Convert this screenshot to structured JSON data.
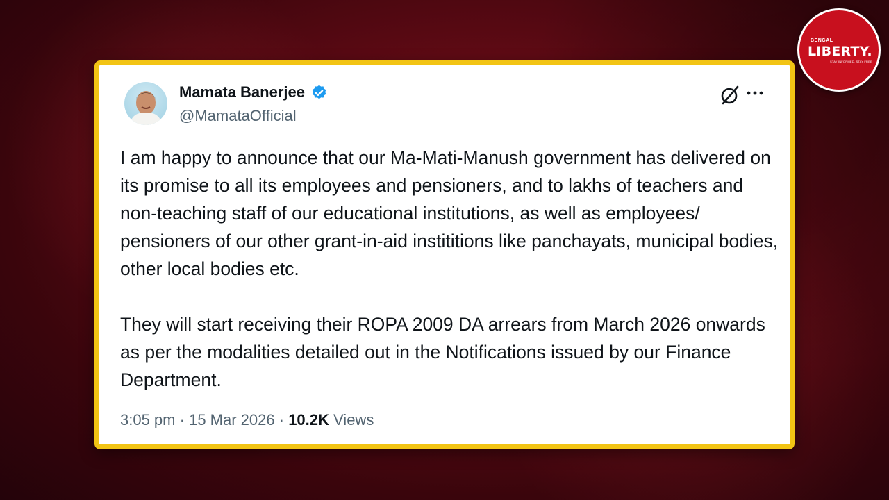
{
  "tweet": {
    "author_name": "Mamata Banerjee",
    "handle": "@MamataOfficial",
    "paragraphs": [
      "I am happy to announce that our Ma-Mati-Manush government has delivered on its promise to all its employees and pensioners, and to lakhs of teachers and non-teaching staff of our educational institutions, as well as employees/ pensioners of our other grant-in-aid instititions like panchayats, municipal bodies, other local bodies etc.",
      "They will start receiving their ROPA 2009 DA arrears from March 2026 onwards as per the modalities detailed out in the Notifications issued by our Finance Department."
    ],
    "time": "3:05 pm",
    "date": "15 Mar 2026",
    "views_count": "10.2K",
    "views_label": "Views",
    "separator": "·",
    "icons": {
      "verified": "verified-badge-icon",
      "grok": "grok-icon",
      "more": "more-options-icon"
    }
  },
  "logo": {
    "small_text": "BENGAL",
    "main_text": "LIBERTY.",
    "tagline": "STAY INFORMED, STAY FREE"
  },
  "colors": {
    "card_border": "#f2c414",
    "verified_blue": "#1d9bf0",
    "logo_red": "#c8101e",
    "background_red": "#5e0a14"
  }
}
